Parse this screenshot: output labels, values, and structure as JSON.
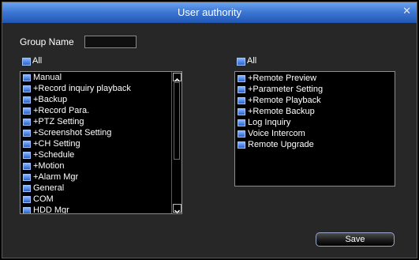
{
  "dialog": {
    "title": "User authority",
    "close_icon": "close-icon"
  },
  "group": {
    "label": "Group Name",
    "value": ""
  },
  "left_panel": {
    "all_label": "All",
    "items": [
      {
        "label": "Manual"
      },
      {
        "label": "+Record inquiry playback"
      },
      {
        "label": "+Backup"
      },
      {
        "label": "+Record Para."
      },
      {
        "label": "+PTZ Setting"
      },
      {
        "label": "+Screenshot Setting"
      },
      {
        "label": "+CH Setting"
      },
      {
        "label": "+Schedule"
      },
      {
        "label": "+Motion"
      },
      {
        "label": "+Alarm Mgr"
      },
      {
        "label": "General"
      },
      {
        "label": "COM"
      },
      {
        "label": "HDD Mgr"
      }
    ]
  },
  "right_panel": {
    "all_label": "All",
    "items": [
      {
        "label": "+Remote Preview"
      },
      {
        "label": "+Parameter Setting"
      },
      {
        "label": "+Remote Playback"
      },
      {
        "label": "+Remote Backup"
      },
      {
        "label": "Log Inquiry"
      },
      {
        "label": "Voice Intercom"
      },
      {
        "label": "Remote Upgrade"
      }
    ]
  },
  "footer": {
    "save_label": "Save"
  },
  "colors": {
    "title_bar": "#3f79d5",
    "checkbox": "#2b64cf",
    "background": "#272727"
  }
}
